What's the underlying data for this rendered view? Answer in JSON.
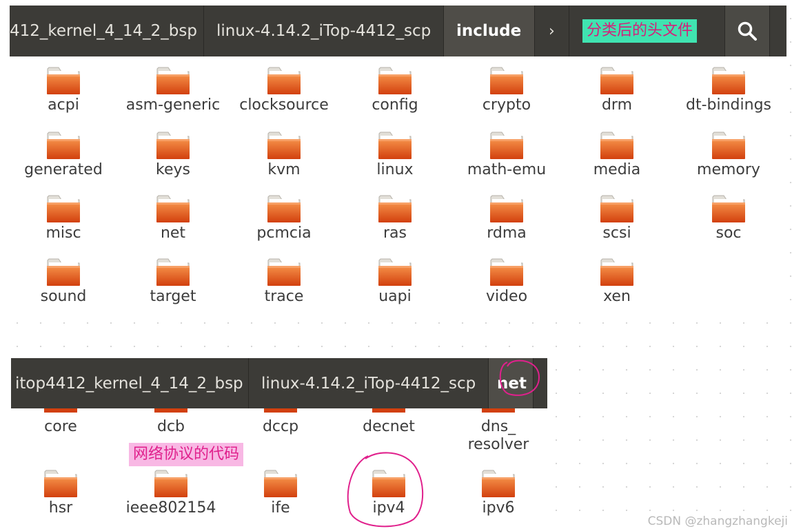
{
  "top_window": {
    "breadcrumbs": [
      "412_kernel_4_14_2_bsp",
      "linux-4.14.2_iTop-4412_scp",
      "include"
    ],
    "forward_arrow": "›",
    "annotation": "分类后的头文件",
    "annotation_color": "#40e3b0",
    "folders": [
      "acpi",
      "asm-generic",
      "clocksource",
      "config",
      "crypto",
      "drm",
      "dt-bindings",
      "generated",
      "keys",
      "kvm",
      "linux",
      "math-emu",
      "media",
      "memory",
      "misc",
      "net",
      "pcmcia",
      "ras",
      "rdma",
      "scsi",
      "soc",
      "sound",
      "target",
      "trace",
      "uapi",
      "video",
      "xen"
    ],
    "search_icon": "search-icon"
  },
  "bottom_window": {
    "breadcrumbs": [
      "itop4412_kernel_4_14_2_bsp",
      "linux-4.14.2_iTop-4412_scp",
      "net"
    ],
    "annotation": "网络协议的代码",
    "annotation_color": "#f8b8e4",
    "folders_row1": [
      "core",
      "dcb",
      "dccp",
      "decnet",
      "dns_\nresolver"
    ],
    "folders_row2": [
      "hsr",
      "ieee802154",
      "ife",
      "ipv4",
      "ipv6"
    ]
  },
  "watermark": "CSDN @zhangzhangkeji",
  "colors": {
    "pathbar": "#3c3b37",
    "folder_orange": "#e85a1c",
    "highlight_stroke": "#e0208c"
  }
}
